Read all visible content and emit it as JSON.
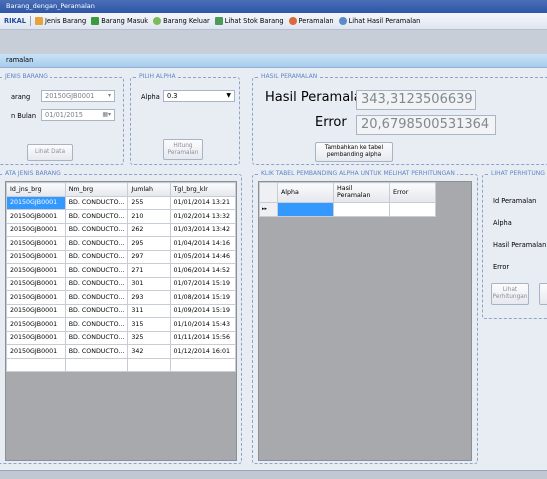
{
  "window": {
    "title": "Barang_dengan_Peramalan"
  },
  "menu": {
    "brand": "RIKAL",
    "items": [
      {
        "label": "Jenis Barang",
        "icon": "folder-icon",
        "color": "#e6a23c"
      },
      {
        "label": "Barang Masuk",
        "icon": "box-in-icon",
        "color": "#3c9b3c"
      },
      {
        "label": "Barang Keluar",
        "icon": "leaf-icon",
        "color": "#7cbb5a"
      },
      {
        "label": "Lihat Stok Barang",
        "icon": "stock-icon",
        "color": "#4a9a5a"
      },
      {
        "label": "Peramalan",
        "icon": "chart-icon",
        "color": "#d96b3a"
      },
      {
        "label": "Lihat Hasil Peramalan",
        "icon": "magnify-icon",
        "color": "#5a8ac8"
      }
    ]
  },
  "form_title": "ramalan",
  "jenis_barang": {
    "title": "JENIS BARANG",
    "barang_label": "arang",
    "barang_value": "20150GJB0001",
    "bulan_label": "n Bulan",
    "bulan_value": "01/01/2015",
    "lihat_data": "Lihat Data"
  },
  "pilih_alpha": {
    "title": "PILIH ALPHA",
    "alpha_label": "Alpha",
    "alpha_value": "0.3",
    "hitung_button": "Hitung\nPeramalan"
  },
  "hasil_peramalan": {
    "title": "HASIL PERAMALAN",
    "hasil_label": "Hasil Peramalan",
    "hasil_value": "343,3123506639",
    "error_label": "Error",
    "error_value": "20,6798500531364",
    "tambahkan_button": "Tambahkan ke tabel\npembanding alpha"
  },
  "data_table": {
    "title": "ATA JENIS BARANG",
    "headers": [
      "Id_jns_brg",
      "Nm_brg",
      "Jumlah",
      "Tgl_brg_klr"
    ],
    "rows": [
      [
        "20150GJB0001",
        "BD. CONDUCTO...",
        "255",
        "01/01/2014 13:21"
      ],
      [
        "20150GJB0001",
        "BD. CONDUCTO...",
        "210",
        "01/02/2014 13:32"
      ],
      [
        "20150GJB0001",
        "BD. CONDUCTO...",
        "262",
        "01/03/2014 13:42"
      ],
      [
        "20150GJB0001",
        "BD. CONDUCTO...",
        "295",
        "01/04/2014 14:16"
      ],
      [
        "20150GJB0001",
        "BD. CONDUCTO...",
        "297",
        "01/05/2014 14:46"
      ],
      [
        "20150GJB0001",
        "BD. CONDUCTO...",
        "271",
        "01/06/2014 14:52"
      ],
      [
        "20150GJB0001",
        "BD. CONDUCTO...",
        "301",
        "01/07/2014 15:19"
      ],
      [
        "20150GJB0001",
        "BD. CONDUCTO...",
        "293",
        "01/08/2014 15:19"
      ],
      [
        "20150GJB0001",
        "BD. CONDUCTO...",
        "311",
        "01/09/2014 15:19"
      ],
      [
        "20150GJB0001",
        "BD. CONDUCTO...",
        "315",
        "01/10/2014 15:43"
      ],
      [
        "20150GJB0001",
        "BD. CONDUCTO...",
        "325",
        "01/11/2014 15:56"
      ],
      [
        "20150GJB0001",
        "BD. CONDUCTO...",
        "342",
        "01/12/2014 16:01"
      ]
    ]
  },
  "alpha_table": {
    "title": "KLIK TABEL PEMBANDING ALPHA UNTUK MELIHAT PERHITUNGAN",
    "headers": [
      "Alpha",
      "Hasil\nPeramalan",
      "Error"
    ],
    "row_marker": "▸▸"
  },
  "lihat_perhitungan": {
    "title": "LIHAT PERHITUNG",
    "labels": [
      "Id Peramalan",
      "Alpha",
      "Hasil Peramalan",
      "Error"
    ],
    "lihat_button": "Lihat\nPerhitungan"
  }
}
